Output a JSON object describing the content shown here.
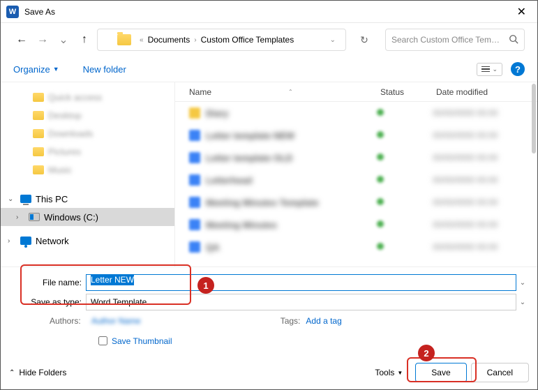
{
  "titlebar": {
    "title": "Save As",
    "word_glyph": "W",
    "close": "✕"
  },
  "nav": {
    "back": "←",
    "forward": "→",
    "recent_dd": "⌄",
    "up": "↑",
    "breadcrumb_prefix": "«",
    "crumb1": "Documents",
    "crumb2": "Custom Office Templates",
    "refresh": "↻",
    "search_placeholder": "Search Custom Office Tem…"
  },
  "toolbar": {
    "organize": "Organize",
    "newfolder": "New folder",
    "view_dd": "⌄",
    "help": "?"
  },
  "sidebar": {
    "thispc": "This PC",
    "windows": "Windows (C:)",
    "network": "Network"
  },
  "filelist": {
    "col_name": "Name",
    "col_status": "Status",
    "col_date": "Date modified",
    "rows": [
      {
        "color": "#f5c842",
        "name": "Diary",
        "date": "00/00/0000 00:00"
      },
      {
        "color": "#3b82f6",
        "name": "Letter template NEW",
        "date": "00/00/0000 00:00"
      },
      {
        "color": "#3b82f6",
        "name": "Letter template OLD",
        "date": "00/00/0000 00:00"
      },
      {
        "color": "#3b82f6",
        "name": "Letterhead",
        "date": "00/00/0000 00:00"
      },
      {
        "color": "#3b82f6",
        "name": "Meeting Minutes Template",
        "date": "00/00/0000 00:00"
      },
      {
        "color": "#3b82f6",
        "name": "Meeting Minutes",
        "date": "00/00/0000 00:00"
      },
      {
        "color": "#3b82f6",
        "name": "QA",
        "date": "00/00/0000 00:00"
      }
    ]
  },
  "fields": {
    "filename_label": "File name:",
    "filename_value": "Letter NEW",
    "savetype_label": "Save as type:",
    "savetype_value": "Word Template"
  },
  "meta": {
    "authors_label": "Authors:",
    "authors_value": "Author Name",
    "tags_label": "Tags:",
    "addtag": "Add a tag",
    "thumb": "Save Thumbnail"
  },
  "buttons": {
    "hidefolders": "Hide Folders",
    "tools": "Tools",
    "save": "Save",
    "cancel": "Cancel"
  },
  "callouts": {
    "one": "1",
    "two": "2"
  }
}
